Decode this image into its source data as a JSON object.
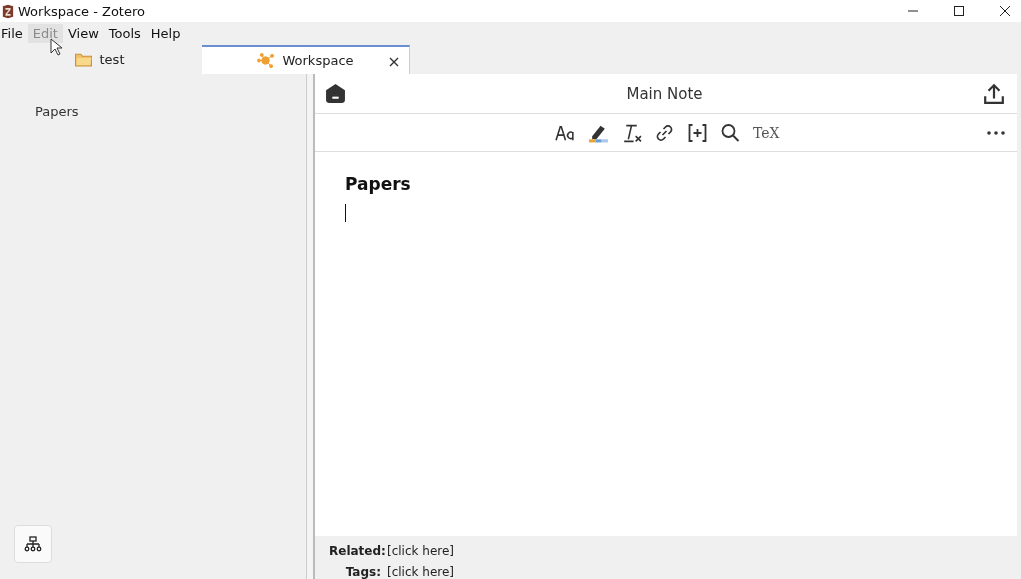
{
  "window": {
    "title": "Workspace - Zotero"
  },
  "menu": [
    {
      "label": "File",
      "selected": false
    },
    {
      "label": "Edit",
      "selected": true
    },
    {
      "label": "View",
      "selected": false
    },
    {
      "label": "Tools",
      "selected": false
    },
    {
      "label": "Help",
      "selected": false
    }
  ],
  "tabs": [
    {
      "label": "test",
      "kind": "folder",
      "selected": false,
      "closable": false
    },
    {
      "label": "Workspace",
      "kind": "workspace",
      "selected": true,
      "closable": true
    }
  ],
  "sidebar": {
    "items": [
      {
        "label": "Papers"
      }
    ]
  },
  "note": {
    "title": "Main Note",
    "toolbar_tex": "TeX",
    "heading": "Papers",
    "footer": [
      {
        "label": "Related:",
        "value": "[click here]"
      },
      {
        "label": "Tags:",
        "value": "[click here]"
      }
    ]
  }
}
